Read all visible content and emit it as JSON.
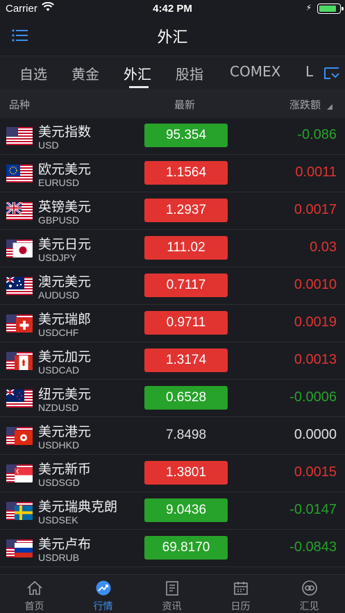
{
  "status_bar": {
    "carrier": "Carrier",
    "time": "4:42 PM",
    "battery_level": 0.9
  },
  "nav": {
    "title": "外汇",
    "menu_icon": "list-menu-icon"
  },
  "tabs": [
    {
      "label": "自选",
      "active": false
    },
    {
      "label": "黄金",
      "active": false
    },
    {
      "label": "外汇",
      "active": true
    },
    {
      "label": "股指",
      "active": false
    },
    {
      "label": "COMEX",
      "active": false
    },
    {
      "label": "L",
      "active": false
    }
  ],
  "columns": {
    "name": "品种",
    "latest": "最新",
    "change": "涨跌额"
  },
  "rows": [
    {
      "name": "美元指数",
      "code": "USD",
      "price": "95.354",
      "change": "-0.086",
      "trend": "down",
      "flag": "us"
    },
    {
      "name": "欧元美元",
      "code": "EURUSD",
      "price": "1.1564",
      "change": "0.0011",
      "trend": "up",
      "flag": "eu"
    },
    {
      "name": "英镑美元",
      "code": "GBPUSD",
      "price": "1.2937",
      "change": "0.0017",
      "trend": "up",
      "flag": "gb"
    },
    {
      "name": "美元日元",
      "code": "USDJPY",
      "price": "111.02",
      "change": "0.03",
      "trend": "up",
      "flag": "jp"
    },
    {
      "name": "澳元美元",
      "code": "AUDUSD",
      "price": "0.7117",
      "change": "0.0010",
      "trend": "up",
      "flag": "au"
    },
    {
      "name": "美元瑞郎",
      "code": "USDCHF",
      "price": "0.9711",
      "change": "0.0019",
      "trend": "up",
      "flag": "ch"
    },
    {
      "name": "美元加元",
      "code": "USDCAD",
      "price": "1.3174",
      "change": "0.0013",
      "trend": "up",
      "flag": "ca"
    },
    {
      "name": "纽元美元",
      "code": "NZDUSD",
      "price": "0.6528",
      "change": "-0.0006",
      "trend": "down",
      "flag": "nz"
    },
    {
      "name": "美元港元",
      "code": "USDHKD",
      "price": "7.8498",
      "change": "0.0000",
      "trend": "flat",
      "flag": "hk"
    },
    {
      "name": "美元新币",
      "code": "USDSGD",
      "price": "1.3801",
      "change": "0.0015",
      "trend": "up",
      "flag": "sg"
    },
    {
      "name": "美元瑞典克朗",
      "code": "USDSEK",
      "price": "9.0436",
      "change": "-0.0147",
      "trend": "down",
      "flag": "se"
    },
    {
      "name": "美元卢布",
      "code": "USDRUB",
      "price": "69.8170",
      "change": "-0.0843",
      "trend": "down",
      "flag": "ru"
    }
  ],
  "bottom_tabs": [
    {
      "label": "首页",
      "icon": "home-icon",
      "active": false
    },
    {
      "label": "行情",
      "icon": "market-chart-icon",
      "active": true
    },
    {
      "label": "资讯",
      "icon": "news-icon",
      "active": false
    },
    {
      "label": "日历",
      "icon": "calendar-icon",
      "active": false
    },
    {
      "label": "汇见",
      "icon": "exchange-icon",
      "active": false
    }
  ],
  "colors": {
    "up": "#e13431",
    "down": "#27a22a",
    "accent": "#3d8ef0",
    "background": "#1b1c21"
  }
}
